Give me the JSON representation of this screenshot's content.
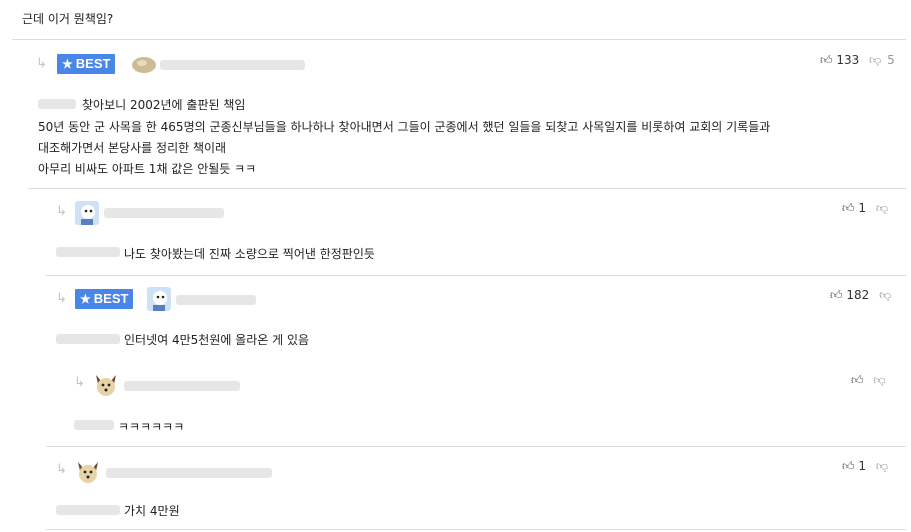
{
  "post": {
    "question": "근데 이거 뭔책임?"
  },
  "badge_label": "BEST",
  "colors": {
    "badge": "#4a86e8",
    "separator": "#dcdcdc"
  },
  "comments": [
    {
      "best": true,
      "lines": [
        "찾아보니 2002년에 출판된 책임",
        "50년 동안 군 사목을 한 465명의 군종신부님들을 하나하나 찾아내면서 그들이 군종에서 했던 일들을 되찾고 사목일지를 비롯하여 교회의 기록들과",
        "대조해가면서 본당사를 정리한 책이래",
        "아무리 비싸도 아파트 1채 값은 안될듯 ㅋㅋ"
      ],
      "likes": "133",
      "dislikes": "5"
    },
    {
      "best": false,
      "lines": [
        "나도 찾아봤는데 진짜 소량으로 찍어낸 한정판인듯"
      ],
      "likes": "1",
      "dislikes": ""
    },
    {
      "best": true,
      "lines": [
        "인터넷여 4만5천원에 올라온 게 있음"
      ],
      "likes": "182",
      "dislikes": ""
    },
    {
      "best": false,
      "lines": [
        "ㅋㅋㅋㅋㅋㅋ"
      ],
      "likes": "",
      "dislikes": ""
    },
    {
      "best": false,
      "lines": [
        "가치 4만원"
      ],
      "likes": "1",
      "dislikes": ""
    }
  ],
  "icons": {
    "reply": "reply-arrow-icon",
    "up": "thumbs-up-icon",
    "down": "thumbs-down-icon",
    "star": "star-icon"
  }
}
